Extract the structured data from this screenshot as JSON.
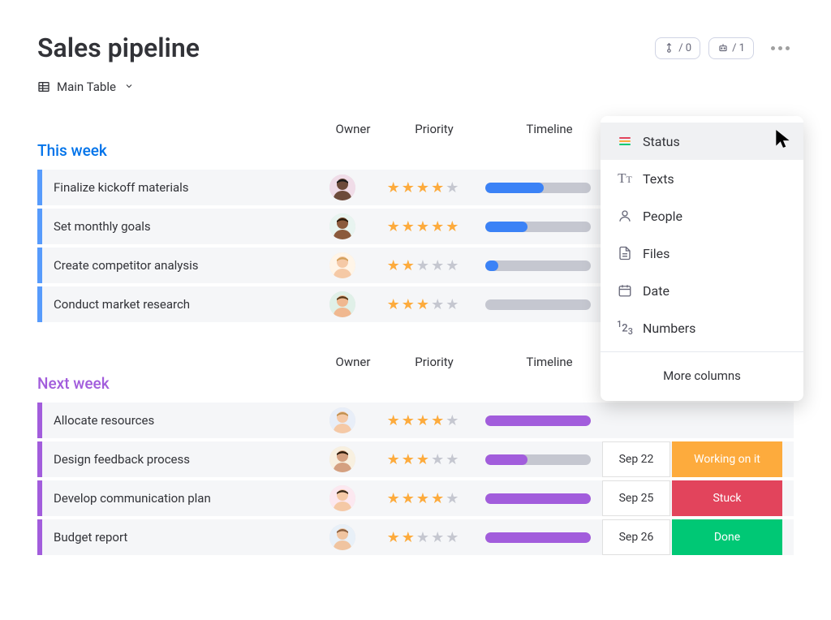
{
  "header": {
    "title": "Sales pipeline",
    "badge1": {
      "icon": "integration-icon",
      "value": "/ 0"
    },
    "badge2": {
      "icon": "automation-icon",
      "value": "/ 1"
    }
  },
  "view": {
    "label": "Main Table"
  },
  "groups": [
    {
      "title": "This week",
      "class": "group-this-week",
      "columns": {
        "owner": "Owner",
        "priority": "Priority",
        "timeline": "Timeline"
      },
      "rows": [
        {
          "task": "Finalize kickoff materials",
          "avatar": 1,
          "stars": 4,
          "progress": 55
        },
        {
          "task": "Set monthly goals",
          "avatar": 2,
          "stars": 5,
          "progress": 40
        },
        {
          "task": "Create competitor analysis",
          "avatar": 3,
          "stars": 2,
          "progress": 12
        },
        {
          "task": "Conduct market research",
          "avatar": 4,
          "stars": 3,
          "progress": 0
        }
      ]
    },
    {
      "title": "Next week",
      "class": "group-next-week",
      "columns": {
        "owner": "Owner",
        "priority": "Priority",
        "timeline": "Timeline"
      },
      "rows": [
        {
          "task": "Allocate resources",
          "avatar": 5,
          "stars": 4,
          "progress": 100,
          "date": "",
          "status": ""
        },
        {
          "task": "Design feedback process",
          "avatar": 6,
          "stars": 3,
          "progress": 40,
          "date": "Sep 22",
          "status": "Working on it",
          "statusClass": "status-working"
        },
        {
          "task": "Develop communication plan",
          "avatar": 7,
          "stars": 4,
          "progress": 100,
          "date": "Sep 25",
          "status": "Stuck",
          "statusClass": "status-stuck"
        },
        {
          "task": "Budget report",
          "avatar": 8,
          "stars": 2,
          "progress": 100,
          "date": "Sep 26",
          "status": "Done",
          "statusClass": "status-done"
        }
      ]
    }
  ],
  "menu": {
    "items": [
      {
        "label": "Status",
        "icon": "status-icon"
      },
      {
        "label": "Texts",
        "icon": "text-icon"
      },
      {
        "label": "People",
        "icon": "people-icon"
      },
      {
        "label": "Files",
        "icon": "files-icon"
      },
      {
        "label": "Date",
        "icon": "date-icon"
      },
      {
        "label": "Numbers",
        "icon": "numbers-icon"
      }
    ],
    "more": "More columns"
  },
  "avatarColors": {
    "1": {
      "skin": "#6d4a3a",
      "hair": "#1a1a1a",
      "bg": "#f0dce8"
    },
    "2": {
      "skin": "#8b5a3c",
      "hair": "#2a1a0a",
      "bg": "#e8f4f0"
    },
    "3": {
      "skin": "#f5c9a6",
      "hair": "#d4a05a",
      "bg": "#fff5e8"
    },
    "4": {
      "skin": "#f0b890",
      "hair": "#5a3a1a",
      "bg": "#e0f0e8"
    },
    "5": {
      "skin": "#f5c9a6",
      "hair": "#c09050",
      "bg": "#e8eef8"
    },
    "6": {
      "skin": "#d4a080",
      "hair": "#2a1a0a",
      "bg": "#f8f0e0"
    },
    "7": {
      "skin": "#f5c9a6",
      "hair": "#3a2a1a",
      "bg": "#fce8f0"
    },
    "8": {
      "skin": "#f0c4a0",
      "hair": "#8a6040",
      "bg": "#e8f0f8"
    }
  }
}
